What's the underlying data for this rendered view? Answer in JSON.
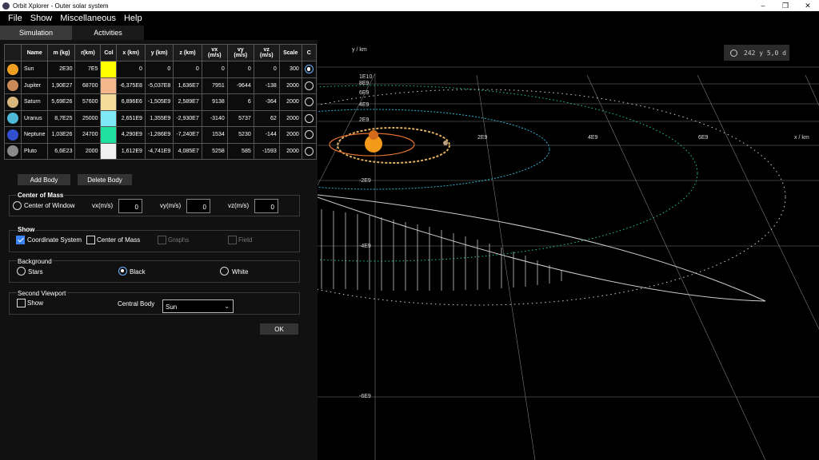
{
  "window": {
    "title": "Orbit Xplorer - Outer solar system"
  },
  "menu": [
    "File",
    "Show",
    "Miscellaneous",
    "Help"
  ],
  "tabs": {
    "simulation": "Simulation",
    "activities": "Activities"
  },
  "table": {
    "headers": [
      "Name",
      "m (kg)",
      "r(km)",
      "Col",
      "x (km)",
      "y (km)",
      "z (km)",
      "vx (m/s)",
      "vy (m/s)",
      "vz (m/s)",
      "Scale",
      "C"
    ],
    "rows": [
      {
        "name": "Sun",
        "m": "2E30",
        "r": "7E5",
        "color": "#ffff00",
        "icon_color": "#f0a020",
        "x": "0",
        "y": "0",
        "z": "0",
        "vx": "0",
        "vy": "0",
        "vz": "0",
        "scale": "300",
        "center": true
      },
      {
        "name": "Jupiter",
        "m": "1,90E27",
        "r": "68700",
        "color": "#f5b88a",
        "icon_color": "#c98a5a",
        "x": "-6,375E8",
        "y": "-5,037E8",
        "z": "1,636E7",
        "vx": "7951",
        "vy": "-9644",
        "vz": "-138",
        "scale": "2000",
        "center": false
      },
      {
        "name": "Saturn",
        "m": "5,69E26",
        "r": "57600",
        "color": "#f5dc9a",
        "icon_color": "#d9b77a",
        "x": "6,896E6",
        "y": "-1,505E9",
        "z": "2,589E7",
        "vx": "9138",
        "vy": "6",
        "vz": "-364",
        "scale": "2000",
        "center": false
      },
      {
        "name": "Uranus",
        "m": "8,7E25",
        "r": "25000",
        "color": "#7ee8f7",
        "icon_color": "#4db8d8",
        "x": "2,651E9",
        "y": "1,355E9",
        "z": "-2,930E7",
        "vx": "-3140",
        "vy": "5737",
        "vz": "62",
        "scale": "2000",
        "center": false
      },
      {
        "name": "Neptune",
        "m": "1,03E26",
        "r": "24700",
        "color": "#20e0a0",
        "icon_color": "#3050d0",
        "x": "4,290E9",
        "y": "-1,286E9",
        "z": "-7,240E7",
        "vx": "1534",
        "vy": "5230",
        "vz": "-144",
        "scale": "2000",
        "center": false
      },
      {
        "name": "Pluto",
        "m": "6,6E23",
        "r": "2000",
        "color": "#f0f0f0",
        "icon_color": "#8a8a8a",
        "x": "1,612E9",
        "y": "-4,741E9",
        "z": "4,085E7",
        "vx": "5258",
        "vy": "585",
        "vz": "-1593",
        "scale": "2000",
        "center": false
      }
    ]
  },
  "buttons": {
    "add_body": "Add Body",
    "delete_body": "Delete Body",
    "ok": "OK"
  },
  "center_of_mass": {
    "title": "Center of Mass",
    "center_of_window": "Center of Window",
    "vx_label": "vx(m/s)",
    "vx": "0",
    "vy_label": "vy(m/s)",
    "vy": "0",
    "vz_label": "vz(m/s)",
    "vz": "0"
  },
  "show": {
    "title": "Show",
    "coordinate_system": "Coordinate System",
    "coordinate_system_checked": true,
    "center_of_mass": "Center of Mass",
    "center_of_mass_checked": false,
    "graphs": "Graphs",
    "field": "Field"
  },
  "background": {
    "title": "Background",
    "stars": "Stars",
    "black": "Black",
    "white": "White",
    "selected": "Black"
  },
  "second_viewport": {
    "title": "Second Viewport",
    "show": "Show",
    "central_body_label": "Central Body",
    "central_body": "Sun"
  },
  "viewport": {
    "timer": "242 y 5,0 d",
    "y_axis_label": "y / km",
    "x_axis_label": "x / km",
    "y_ticks": [
      "1E10",
      "8E9",
      "6E9",
      "4E9",
      "2E9",
      "-2E9",
      "-4E9",
      "-6E9"
    ],
    "x_ticks": [
      "2E9",
      "4E9",
      "6E9"
    ]
  }
}
